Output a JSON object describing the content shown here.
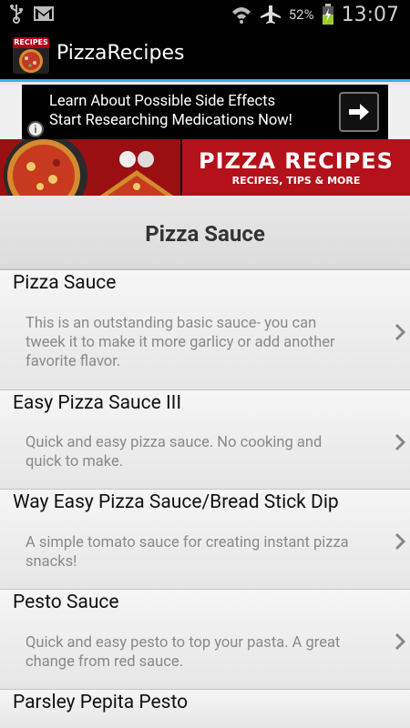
{
  "status_bar": {
    "battery_percent": "52%",
    "time": "13:07",
    "icons": [
      "usb-icon",
      "gmail-icon",
      "wifi-icon",
      "airplane-icon",
      "battery-icon"
    ]
  },
  "action_bar": {
    "app_icon_label": "RECIPES",
    "title": "PizzaRecipes"
  },
  "ad": {
    "line1": "Learn About Possible Side Effects",
    "line2": "Start Researching Medications Now!",
    "info_glyph": "i"
  },
  "promo": {
    "title": "PIZZA RECIPES",
    "subtitle": "RECIPES, TIPS & MORE"
  },
  "section": {
    "title": "Pizza Sauce"
  },
  "items": [
    {
      "title": "Pizza Sauce",
      "desc_lines": [
        "This is an outstanding basic sauce- you can",
        "tweek it to make it more garlicy or add another",
        "favorite flavor."
      ]
    },
    {
      "title": "Easy Pizza Sauce III",
      "desc_lines": [
        "Quick and easy pizza sauce. No cooking and",
        "quick to make."
      ]
    },
    {
      "title": "Way Easy Pizza Sauce/Bread Stick Dip",
      "desc_lines": [
        "A simple tomato sauce for creating instant pizza",
        "snacks!"
      ]
    },
    {
      "title": "Pesto Sauce",
      "desc_lines": [
        "Quick and easy pesto to top your pasta. A great",
        "change from red sauce."
      ]
    },
    {
      "title": "Parsley Pepita Pesto",
      "desc_lines": []
    }
  ],
  "colors": {
    "accent": "#33b5e5",
    "promo_red": "#b4111a",
    "list_text": "#111111",
    "desc_text": "#8a8a8a"
  }
}
